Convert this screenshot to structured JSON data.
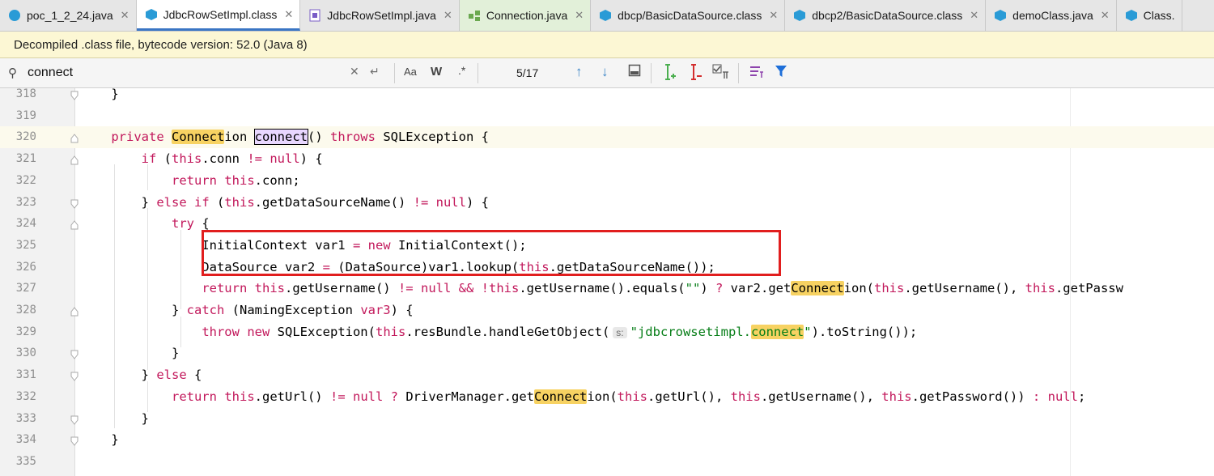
{
  "tabs": [
    {
      "label": "poc_1_2_24.java",
      "icon": "java-class-icon",
      "active": false,
      "green": false
    },
    {
      "label": "JdbcRowSetImpl.class",
      "icon": "class-file-icon",
      "active": true,
      "green": false
    },
    {
      "label": "JdbcRowSetImpl.java",
      "icon": "java-source-icon",
      "active": false,
      "green": false
    },
    {
      "label": "Connection.java",
      "icon": "interface-icon",
      "active": false,
      "green": true
    },
    {
      "label": "dbcp/BasicDataSource.class",
      "icon": "class-file-icon",
      "active": false,
      "green": false
    },
    {
      "label": "dbcp2/BasicDataSource.class",
      "icon": "class-file-icon",
      "active": false,
      "green": false
    },
    {
      "label": "demoClass.java",
      "icon": "java-class-icon",
      "active": false,
      "green": false
    },
    {
      "label": "Class.",
      "icon": "class-file-icon",
      "active": false,
      "green": false
    }
  ],
  "banner": {
    "text": "Decompiled .class file, bytecode version: 52.0 (Java 8)"
  },
  "search": {
    "query": "connect",
    "match_case": "Aa",
    "words": "W",
    "regex": ".*",
    "count": "5/17"
  },
  "lines": {
    "n318": "318",
    "n319": "319",
    "n320": "320",
    "n321": "321",
    "n322": "322",
    "n323": "323",
    "n324": "324",
    "n325": "325",
    "n326": "326",
    "n327": "327",
    "n328": "328",
    "n329": "329",
    "n330": "330",
    "n331": "331",
    "n332": "332",
    "n333": "333",
    "n334": "334",
    "n335": "335"
  },
  "colors": {
    "accent": "#3a75c4",
    "match": "#f7d262",
    "highlight_box": "#e11e1e",
    "keyword": "#c2185b",
    "string": "#067d17"
  }
}
